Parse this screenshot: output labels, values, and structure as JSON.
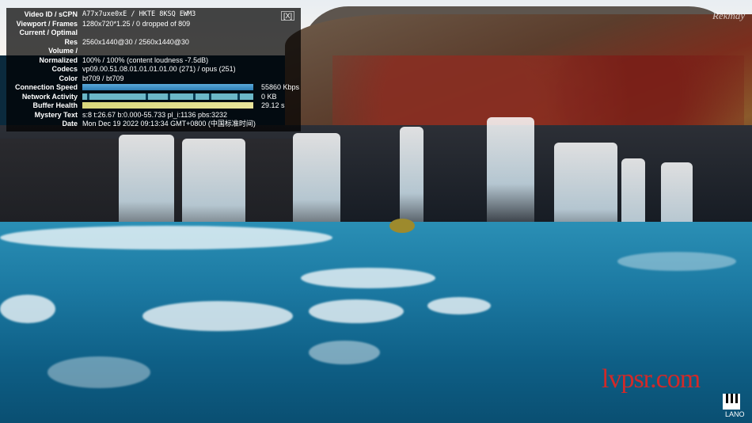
{
  "stats_panel": {
    "close_label": "[X]",
    "rows": [
      {
        "label": "Video ID / sCPN",
        "value": "A77x7uxe0xE  /  HKTE  8KSQ  EWM3"
      },
      {
        "label": "Viewport / Frames",
        "value": "1280x720*1.25 / 0 dropped of 809"
      },
      {
        "label": "Current / Optimal",
        "value": ""
      },
      {
        "label": "Res",
        "value": "2560x1440@30 / 2560x1440@30"
      },
      {
        "label": "Volume /",
        "value": ""
      },
      {
        "label": "Normalized",
        "value": "100% / 100% (content loudness -7.5dB)"
      },
      {
        "label": "Codecs",
        "value": "vp09.00.51.08.01.01.01.01.00 (271) / opus (251)"
      },
      {
        "label": "Color",
        "value": "bt709 / bt709"
      },
      {
        "label": "Connection Speed",
        "value": "55860 Kbps",
        "fill": 1.0
      },
      {
        "label": "Network Activity",
        "value": "0 KB",
        "fill": 1.0
      },
      {
        "label": "Buffer Health",
        "value": "29.12 s",
        "fill": 1.0
      },
      {
        "label": "Mystery Text",
        "value": "s:8 t:26.67 b:0.000-55.733 pl_i:1136 pbs:3232"
      },
      {
        "label": "Date",
        "value": "Mon Dec 19 2022 09:13:34 GMT+0800 (中国标准时间)"
      }
    ]
  },
  "overlay": {
    "watermark": "lvpsr.com",
    "logo_text": "LANO",
    "corner_signature": "Rekmay"
  },
  "colors": {
    "panel_bg": "rgba(0,0,0,0.72)",
    "connection_bar": "#3a8fca",
    "network_bar": "#6bb7c7",
    "buffer_bar": "#e0dc8a",
    "watermark": "#e8241f"
  },
  "icons": {
    "logo": "piano-keys-icon"
  }
}
